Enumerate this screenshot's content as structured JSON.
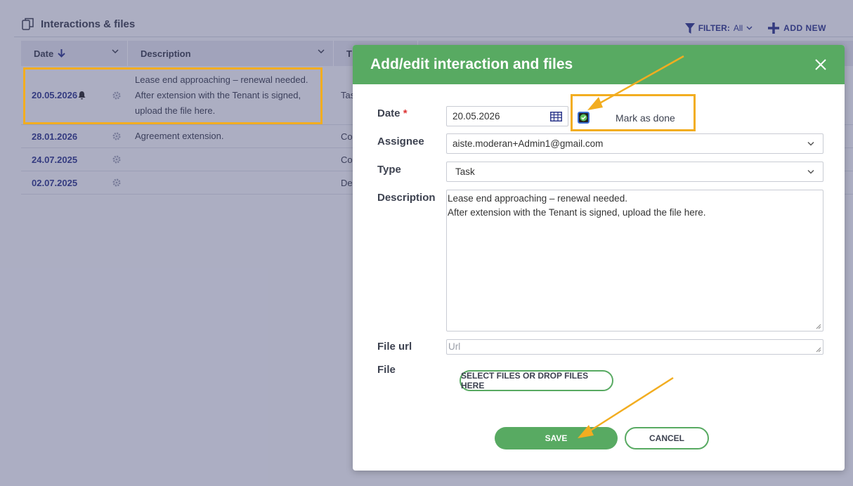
{
  "section": {
    "title": "Interactions & files",
    "filter_label": "FILTER:",
    "filter_value": "All",
    "add_new_label": "ADD NEW"
  },
  "table": {
    "columns": [
      "Date",
      "Description",
      "T"
    ],
    "rows": [
      {
        "date": "20.05.2026",
        "description_lines": [
          "Lease end approaching – renewal needed.",
          "After extension with the Tenant is signed,",
          "upload the file here."
        ],
        "type": "Tas"
      },
      {
        "date": "28.01.2026",
        "description_lines": [
          "Agreement extension."
        ],
        "type": "Co"
      },
      {
        "date": "24.07.2025",
        "description_lines": [
          ""
        ],
        "type": "Co"
      },
      {
        "date": "02.07.2025",
        "description_lines": [
          ""
        ],
        "type": "De"
      }
    ]
  },
  "modal": {
    "title": "Add/edit interaction and files",
    "date_label": "Date",
    "required_mark": "*",
    "date_value": "20.05.2026",
    "mark_done_label": "Mark as done",
    "mark_done_checked": true,
    "assignee_label": "Assignee",
    "assignee_value": "aiste.moderan+Admin1@gmail.com",
    "type_label": "Type",
    "type_value": "Task",
    "description_label": "Description",
    "description_lines": [
      "Lease end approaching – renewal needed.",
      "After extension with the Tenant is signed, upload the file here."
    ],
    "file_url_label": "File url",
    "file_url_placeholder": "Url",
    "file_label": "File",
    "select_files_label": "SELECT FILES OR DROP FILES HERE",
    "save_label": "SAVE",
    "cancel_label": "CANCEL"
  },
  "colors": {
    "accent_green": "#58aa62",
    "link_blue": "#2f3a8c",
    "highlight_orange": "#f2ad20"
  },
  "icons": [
    "copy-icon",
    "filter-icon",
    "chevron-down-icon",
    "plus-icon",
    "arrow-down-icon",
    "bell-icon",
    "gear-icon",
    "close-icon",
    "calendar-icon",
    "checkbox-icon",
    "resize-grip-icon"
  ]
}
